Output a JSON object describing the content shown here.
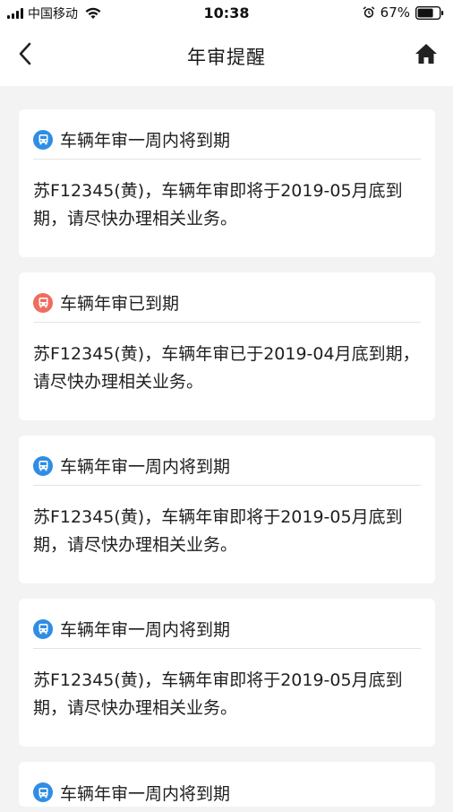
{
  "status_bar": {
    "carrier": "中国移动",
    "time": "10:38",
    "battery": "67%"
  },
  "header": {
    "title": "年审提醒"
  },
  "colors": {
    "blue_icon": "#2f8de4",
    "red_icon": "#ee6d5f"
  },
  "cards": [
    {
      "title": "车辆年审一周内将到期",
      "body": "苏F12345(黄)，车辆年审即将于2019-05月底到期，请尽快办理相关业务。",
      "icon": "bus-icon-blue"
    },
    {
      "title": "车辆年审已到期",
      "body": "苏F12345(黄)，车辆年审已于2019-04月底到期，请尽快办理相关业务。",
      "icon": "bus-icon-red"
    },
    {
      "title": "车辆年审一周内将到期",
      "body": "苏F12345(黄)，车辆年审即将于2019-05月底到期，请尽快办理相关业务。",
      "icon": "bus-icon-blue"
    },
    {
      "title": "车辆年审一周内将到期",
      "body": "苏F12345(黄)，车辆年审即将于2019-05月底到期，请尽快办理相关业务。",
      "icon": "bus-icon-blue"
    },
    {
      "title": "车辆年审一周内将到期",
      "body": "",
      "icon": "bus-icon-blue"
    }
  ]
}
